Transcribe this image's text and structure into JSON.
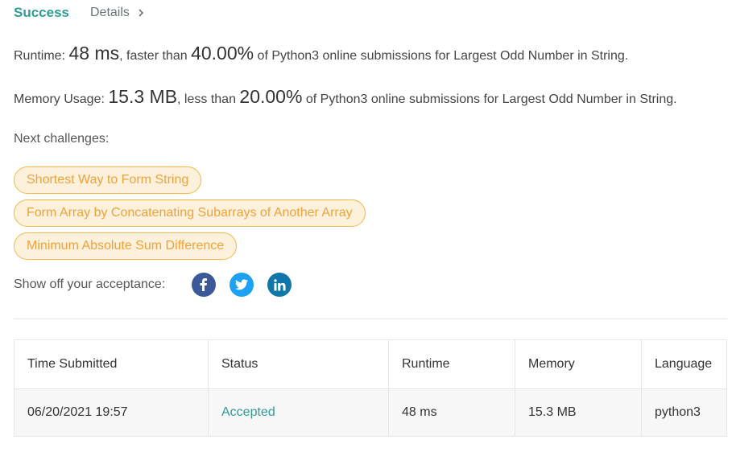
{
  "header": {
    "status": "Success",
    "details_label": "Details"
  },
  "runtime_line": {
    "label": "Runtime:",
    "value": "48 ms",
    "mid_text": ", faster than",
    "percent": "40.00%",
    "suffix": "of Python3 online submissions for Largest Odd Number in String."
  },
  "memory_line": {
    "label": "Memory Usage:",
    "value": "15.3 MB",
    "mid_text": ", less than",
    "percent": "20.00%",
    "suffix": "of Python3 online submissions for Largest Odd Number in String."
  },
  "next_challenges": {
    "label": "Next challenges:",
    "items": [
      "Shortest Way to Form String",
      "Form Array by Concatenating Subarrays of Another Array",
      "Minimum Absolute Sum Difference"
    ]
  },
  "share": {
    "label": "Show off your acceptance:",
    "icons": [
      "facebook-icon",
      "twitter-icon",
      "linkedin-icon"
    ]
  },
  "table": {
    "headers": [
      "Time Submitted",
      "Status",
      "Runtime",
      "Memory",
      "Language"
    ],
    "rows": [
      {
        "time": "06/20/2021 19:57",
        "status": "Accepted",
        "runtime": "48 ms",
        "memory": "15.3 MB",
        "language": "python3"
      }
    ]
  },
  "colors": {
    "success": "#2f9c94",
    "pill_border": "#f2b84a",
    "pill_bg": "#fdf1dc",
    "pill_text": "#efa23c",
    "facebook": "#3b5998",
    "twitter": "#1da1f2",
    "linkedin": "#0e76a8"
  }
}
